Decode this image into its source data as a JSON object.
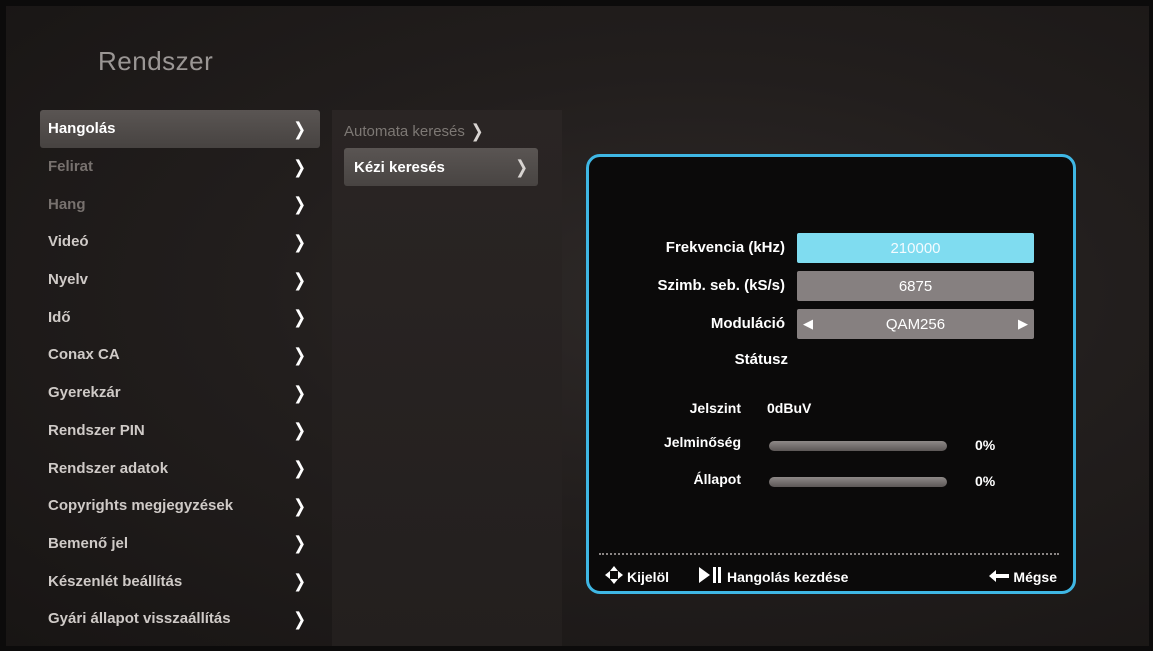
{
  "app": {
    "title": "Rendszer"
  },
  "sidebar": {
    "items": [
      {
        "label": "Hangolás"
      },
      {
        "label": "Felirat"
      },
      {
        "label": "Hang"
      },
      {
        "label": "Videó"
      },
      {
        "label": "Nyelv"
      },
      {
        "label": "Idő"
      },
      {
        "label": "Conax CA"
      },
      {
        "label": "Gyerekzár"
      },
      {
        "label": "Rendszer PIN"
      },
      {
        "label": "Rendszer adatok"
      },
      {
        "label": "Copyrights megjegyzések"
      },
      {
        "label": "Bemenő jel"
      },
      {
        "label": "Készenlét beállítás"
      },
      {
        "label": "Gyári állapot visszaállítás"
      }
    ]
  },
  "submenu": {
    "items": [
      {
        "label": "Automata keresés"
      },
      {
        "label": "Kézi keresés"
      }
    ]
  },
  "dialog": {
    "fields": {
      "frequency": {
        "label": "Frekvencia (kHz)",
        "value": "210000"
      },
      "symbol_rate": {
        "label": "Szimb. seb. (kS/s)",
        "value": "6875"
      },
      "modulation": {
        "label": "Moduláció",
        "value": "QAM256"
      }
    },
    "status_label": "Státusz",
    "signal": {
      "level_label": "Jelszint",
      "level_value": "0dBuV",
      "quality_label": "Jelminőség",
      "quality_value": "0%",
      "quality_fraction": 0,
      "state_label": "Állapot",
      "state_value": "0%",
      "state_fraction": 0
    },
    "footer": {
      "select_label": "Kijelöl",
      "start_label": "Hangolás kezdése",
      "cancel_label": "Mégse"
    }
  },
  "icons": {
    "select": "four-way-arrow-icon",
    "start": "play-pause-icon",
    "cancel": "back-arrow-icon"
  },
  "colors": {
    "accent": "#3fb7e4",
    "field_highlight": "#7fdcf0",
    "field_grey": "#868080"
  }
}
